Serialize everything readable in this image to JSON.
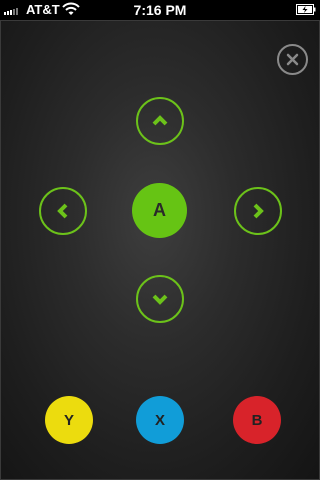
{
  "status_bar": {
    "carrier": "AT&T",
    "time": "7:16 PM",
    "signal_icon": "signal-bars-icon",
    "wifi_icon": "wifi-icon",
    "battery_icon": "battery-charging-icon"
  },
  "controller": {
    "close_icon": "close-icon",
    "dpad": {
      "up_icon": "chevron-up-icon",
      "down_icon": "chevron-down-icon",
      "left_icon": "chevron-left-icon",
      "right_icon": "chevron-right-icon",
      "accent_color": "#6cc21a"
    },
    "a_button": {
      "label": "A",
      "color": "#66c414"
    },
    "face_buttons": {
      "y": {
        "label": "Y",
        "color": "#ecdc0e"
      },
      "x": {
        "label": "X",
        "color": "#119dd8"
      },
      "b": {
        "label": "B",
        "color": "#d8232a"
      }
    }
  }
}
